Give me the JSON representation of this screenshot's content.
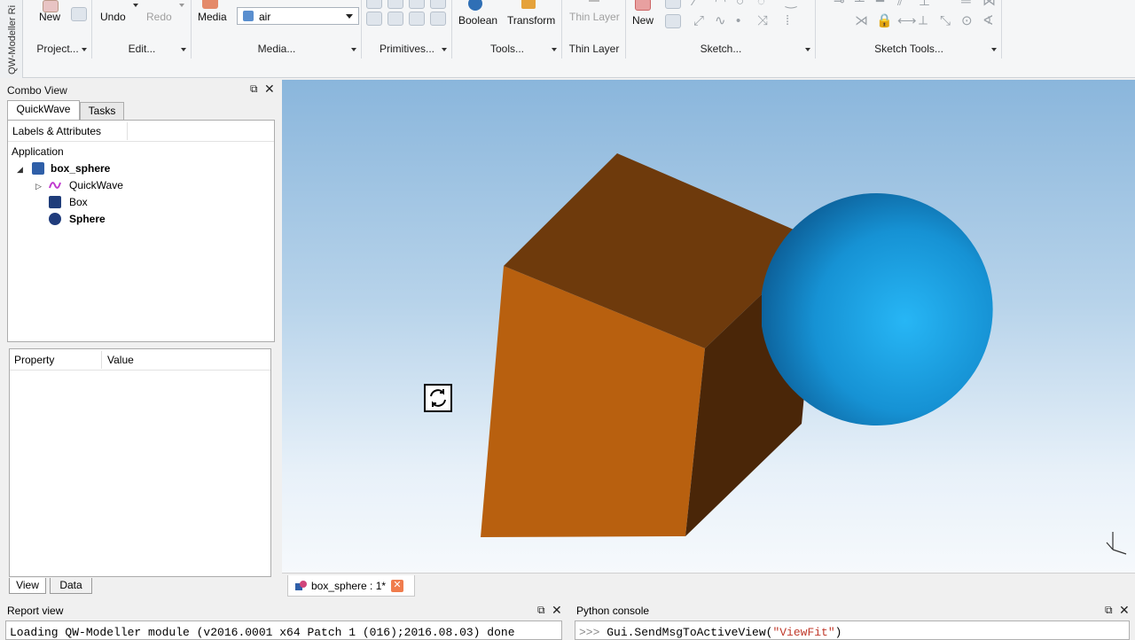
{
  "ribbon": {
    "side_label": "QW-Modeller Ri",
    "groups": {
      "project": {
        "label": "Project...",
        "buttons": {
          "new": "New"
        }
      },
      "edit": {
        "label": "Edit...",
        "buttons": {
          "undo": "Undo",
          "redo": "Redo"
        }
      },
      "media": {
        "label": "Media...",
        "button": "Media",
        "select_value": "air"
      },
      "primitives": {
        "label": "Primitives..."
      },
      "tools": {
        "label": "Tools...",
        "buttons": {
          "boolean": "Boolean",
          "transform": "Transform"
        }
      },
      "thin_layer": {
        "label": "Thin Layer",
        "button": "Thin Layer"
      },
      "sketch": {
        "label": "Sketch...",
        "button_new": "New"
      },
      "sketch_tools": {
        "label": "Sketch Tools..."
      }
    }
  },
  "combo_view": {
    "title": "Combo View",
    "tabs": [
      "QuickWave",
      "Tasks"
    ],
    "tree": {
      "header": "Labels & Attributes",
      "root": "Application",
      "document": "box_sphere",
      "children": [
        "QuickWave",
        "Box",
        "Sphere"
      ]
    },
    "properties": {
      "columns": [
        "Property",
        "Value"
      ]
    },
    "bottom_tabs": [
      "View",
      "Data"
    ]
  },
  "document_tab": {
    "label": "box_sphere : 1*"
  },
  "report_view": {
    "title": "Report view",
    "text": "Loading QW-Modeller module (v2016.0001 x64 Patch 1 (016);2016.08.03) done"
  },
  "python_console": {
    "title": "Python console",
    "prompt": ">>>",
    "code": "Gui.SendMsgToActiveView(",
    "string_arg": "\"ViewFit\"",
    "close_paren": ")"
  },
  "colors": {
    "box_front": "#b8600f",
    "box_top": "#6e3a0c",
    "box_side": "#4a2608",
    "sphere": "#1ea3e6",
    "background_top": "#8ab6dc",
    "background_bottom": "#f6f9fc"
  }
}
